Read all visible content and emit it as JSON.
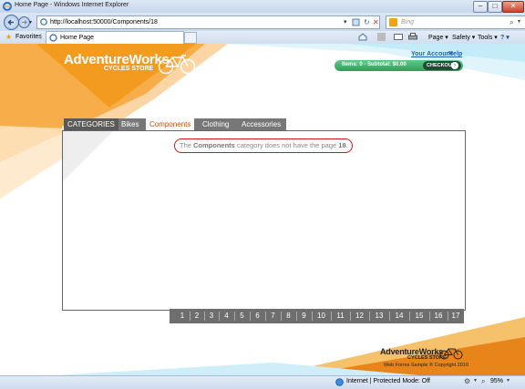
{
  "window": {
    "title": "Home Page - Windows Internet Explorer",
    "minimize": "–",
    "maximize": "□",
    "close": "✕"
  },
  "address": {
    "url": "http://localhost:50000/Components/18"
  },
  "search": {
    "placeholder": "Bing"
  },
  "favorites": {
    "label": "Favorites"
  },
  "browser_tab": {
    "label": "Home Page"
  },
  "commandbar": {
    "page": "Page ▾",
    "safety": "Safety ▾",
    "tools": "Tools ▾",
    "help": "? ▾"
  },
  "site": {
    "logo_bold": "AdventureWorks",
    "logo_sub": "CYCLES STORE",
    "account_link": "Your Account",
    "help_link": "Help",
    "cart_summary": "Items: 0 - Subtotal: $0.00",
    "checkout": "CHECKOUT",
    "colors": {
      "orange": "#f39b1f",
      "cart_green": "#3fb66b"
    }
  },
  "categories": {
    "title": "CATEGORIES",
    "items": [
      {
        "label": "Bikes"
      },
      {
        "label": "Components"
      },
      {
        "label": "Clothing"
      },
      {
        "label": "Accessories"
      }
    ]
  },
  "message": {
    "pre": "The ",
    "category": "Components",
    "mid": " category does not have the page ",
    "page": "18",
    "post": "."
  },
  "pager": {
    "pages": [
      "1",
      "2",
      "3",
      "4",
      "5",
      "6",
      "7",
      "8",
      "9",
      "10",
      "11",
      "12",
      "13",
      "14",
      "15",
      "16",
      "17"
    ]
  },
  "footer": {
    "logo_bold": "AdventureWorks",
    "logo_sub": "CYCLES STORE",
    "copyright": "Web Forms Sample ® Copyright 2010"
  },
  "statusbar": {
    "zone": "Internet | Protected Mode: Off",
    "zoom": "95%"
  }
}
